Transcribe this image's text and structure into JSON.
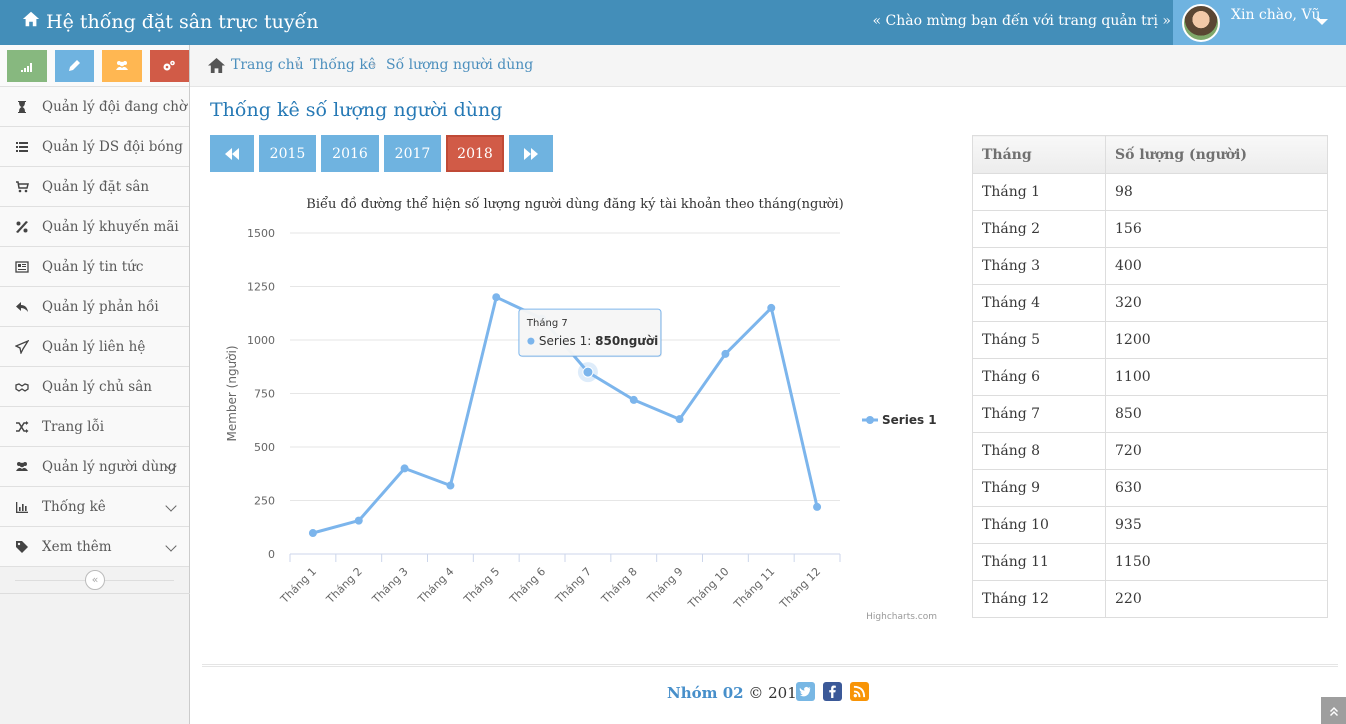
{
  "header": {
    "brand": "Hệ thống đặt sân trực tuyến",
    "welcome": "« Chào mừng bạn đến với trang quản trị »",
    "greeting": "Xin chào, Vũ"
  },
  "shortcuts": [
    {
      "name": "stats-shortcut",
      "color": "#87b87f",
      "icon": "signal-icon"
    },
    {
      "name": "edit-shortcut",
      "color": "#6fb3e0",
      "icon": "pencil-icon"
    },
    {
      "name": "users-shortcut",
      "color": "#ffb752",
      "icon": "users-icon"
    },
    {
      "name": "settings-shortcut",
      "color": "#d15b47",
      "icon": "cogs-icon"
    }
  ],
  "sidebar": {
    "items": [
      {
        "label": "Quản lý đội đang chờ",
        "icon": "hourglass-icon"
      },
      {
        "label": "Quản lý DS đội bóng",
        "icon": "list-icon"
      },
      {
        "label": "Quản lý đặt sân",
        "icon": "cart-icon"
      },
      {
        "label": "Quản lý khuyến mãi",
        "icon": "percent-icon"
      },
      {
        "label": "Quản lý tin tức",
        "icon": "newspaper-icon"
      },
      {
        "label": "Quản lý phản hồi",
        "icon": "reply-icon"
      },
      {
        "label": "Quản lý liên hệ",
        "icon": "send-icon"
      },
      {
        "label": "Quản lý chủ sân",
        "icon": "handshake-icon"
      },
      {
        "label": "Trang lỗi",
        "icon": "random-icon"
      },
      {
        "label": "Quản lý người dùng",
        "icon": "users-icon"
      },
      {
        "label": "Thống kê",
        "icon": "bar-chart-icon"
      },
      {
        "label": "Xem thêm",
        "icon": "tag-icon"
      }
    ],
    "collapse": "«"
  },
  "breadcrumb": {
    "home": "Trang chủ",
    "section": "Thống kê",
    "current": "Số lượng người dùng"
  },
  "page": {
    "title": "Thống kê số lượng người dùng"
  },
  "years": {
    "list": [
      "2015",
      "2016",
      "2017",
      "2018"
    ],
    "active": "2018"
  },
  "chart_data": {
    "type": "line",
    "title": "Biểu đồ đường thể hiện số lượng người dùng đăng ký tài khoản theo tháng(người)",
    "ylabel": "Member (người)",
    "xlabel": "",
    "ylim": [
      0,
      1500
    ],
    "yticks": [
      0,
      250,
      500,
      750,
      1000,
      1250,
      1500
    ],
    "categories": [
      "Tháng 1",
      "Tháng 2",
      "Tháng 3",
      "Tháng 4",
      "Tháng 5",
      "Tháng 6",
      "Tháng 7",
      "Tháng 8",
      "Tháng 9",
      "Tháng 10",
      "Tháng 11",
      "Tháng 12"
    ],
    "series": [
      {
        "name": "Series 1",
        "values": [
          98,
          156,
          400,
          320,
          1200,
          1100,
          850,
          720,
          630,
          935,
          1150,
          220
        ]
      }
    ],
    "color": "#7cb5ec",
    "legend": "right",
    "grid": true,
    "tooltip": {
      "category": "Tháng 7",
      "series": "Series 1",
      "value": "850người"
    },
    "credits": "Highcharts.com"
  },
  "table": {
    "headers": [
      "Tháng",
      "Số lượng (người)"
    ],
    "rows": [
      [
        "Tháng 1",
        "98"
      ],
      [
        "Tháng 2",
        "156"
      ],
      [
        "Tháng 3",
        "400"
      ],
      [
        "Tháng 4",
        "320"
      ],
      [
        "Tháng 5",
        "1200"
      ],
      [
        "Tháng 6",
        "1100"
      ],
      [
        "Tháng 7",
        "850"
      ],
      [
        "Tháng 8",
        "720"
      ],
      [
        "Tháng 9",
        "630"
      ],
      [
        "Tháng 10",
        "935"
      ],
      [
        "Tháng 11",
        "1150"
      ],
      [
        "Tháng 12",
        "220"
      ]
    ]
  },
  "footer": {
    "team": "Nhóm 02",
    "copyright": "© 2018"
  },
  "colors": {
    "navbar": "#438eb9",
    "accent": "#6fb3e0",
    "active_year": "#d15b47",
    "twitter": "#78b7e4",
    "facebook": "#3b5998",
    "rss": "#f89406"
  }
}
